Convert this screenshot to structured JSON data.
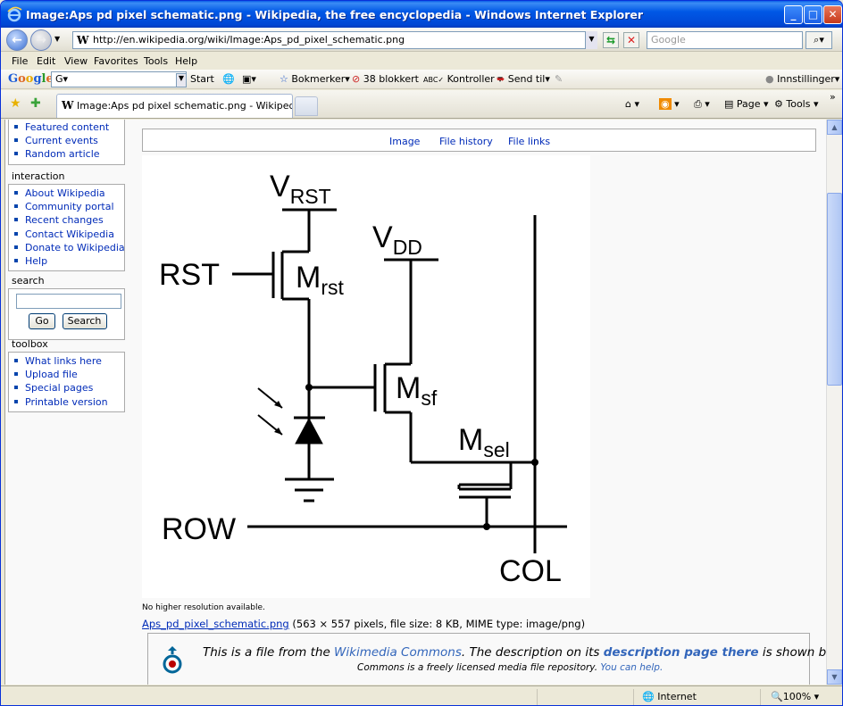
{
  "window": {
    "title": "Image:Aps pd pixel schematic.png - Wikipedia, the free encyclopedia - Windows Internet Explorer",
    "minimize": "_",
    "maximize": "□",
    "close": "✕"
  },
  "address": {
    "url": "http://en.wikipedia.org/wiki/Image:Aps_pd_pixel_schematic.png",
    "search_placeholder": "Google"
  },
  "menu": [
    "File",
    "Edit",
    "View",
    "Favorites",
    "Tools",
    "Help"
  ],
  "google_toolbar": {
    "logo": "Google",
    "box_text": "G▾",
    "start": "Start",
    "bookmarks": "Bokmerker▾",
    "blocked": "38 blokkert",
    "check": "Kontroller",
    "send": "Send til▾",
    "settings": "Innstillinger▾"
  },
  "tabs": {
    "active_title": "Image:Aps pd pixel schematic.png - Wikipedia, the fre..."
  },
  "commands": {
    "page": "Page",
    "tools": "Tools"
  },
  "sidebar": {
    "nav_items": [
      "Featured content",
      "Current events",
      "Random article"
    ],
    "interaction": {
      "title": "interaction",
      "items": [
        "About Wikipedia",
        "Community portal",
        "Recent changes",
        "Contact Wikipedia",
        "Donate to Wikipedia",
        "Help"
      ]
    },
    "search": {
      "title": "search",
      "go": "Go",
      "search": "Search"
    },
    "toolbox": {
      "title": "toolbox",
      "items": [
        "What links here",
        "Upload file",
        "Special pages",
        "Printable version"
      ]
    }
  },
  "file_toc": [
    "Image",
    "File history",
    "File links"
  ],
  "schematic": {
    "labels": {
      "vrst_main": "V",
      "vrst_sub": "RST",
      "vdd_main": "V",
      "vdd_sub": "DD",
      "rst": "RST",
      "mrst_main": "M",
      "mrst_sub": "rst",
      "msf_main": "M",
      "msf_sub": "sf",
      "msel_main": "M",
      "msel_sub": "sel",
      "row": "ROW",
      "col": "COL"
    }
  },
  "file": {
    "no_higher": "No higher resolution available.",
    "link": "Aps_pd_pixel_schematic.png",
    "info": " (563 × 557 pixels, file size: 8 KB, MIME type: image/png)"
  },
  "commons": {
    "t1": "This is a file from the ",
    "t1_link": "Wikimedia Commons",
    "t2": ". The description on its ",
    "t2_link": "description page there",
    "t3": " is shown below.",
    "line2": "Commons is a freely licensed media file repository. ",
    "line2_link": "You can help."
  },
  "status": {
    "zone": "Internet",
    "zoom": "100%"
  }
}
